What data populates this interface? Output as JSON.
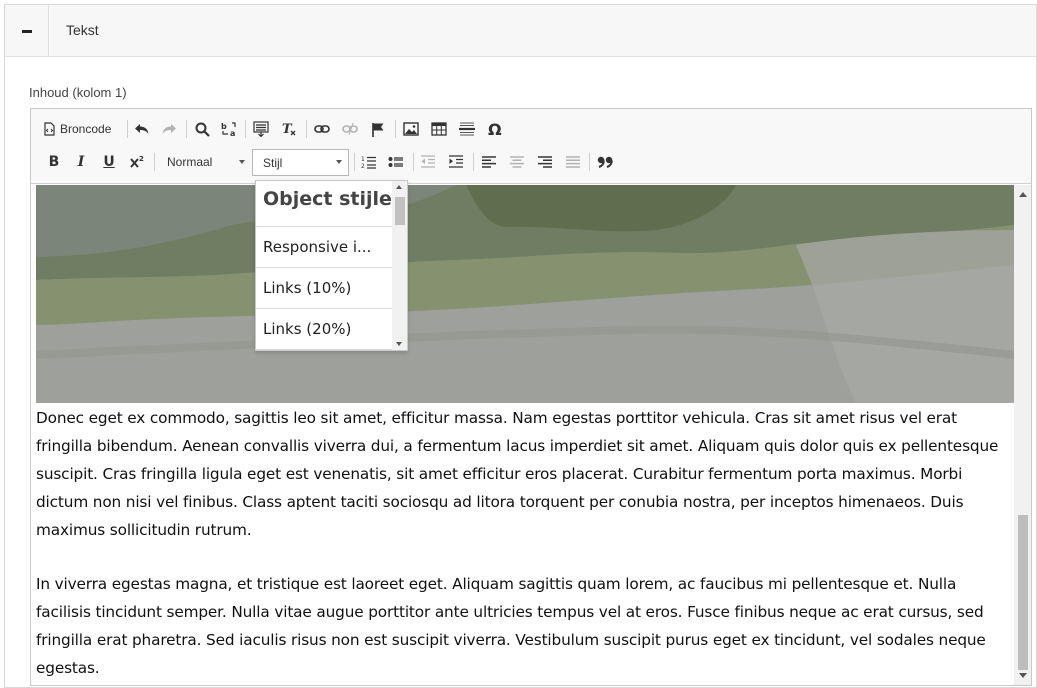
{
  "panel": {
    "title": "Tekst",
    "toggle_icon": "minus-icon"
  },
  "field": {
    "label": "Inhoud (kolom 1)"
  },
  "toolbar": {
    "source_label": "Broncode",
    "format_value": "Normaal",
    "style_value": "Stijl"
  },
  "style_dropdown": {
    "heading": "Object stijlen",
    "items": [
      "Responsive i...",
      "Links (10%)",
      "Links (20%)"
    ]
  },
  "content": {
    "paragraphs": [
      "Donec eget ex commodo, sagittis leo sit amet, efficitur massa. Nam egestas porttitor vehicula. Cras sit amet risus vel erat fringilla bibendum. Aenean convallis viverra dui, a fermentum lacus imperdiet sit amet. Aliquam quis dolor quis ex pellentesque suscipit. Cras fringilla ligula eget est venenatis, sit amet efficitur eros placerat. Curabitur fermentum porta maximus. Morbi dictum non nisi vel finibus. Class aptent taciti sociosqu ad litora torquent per conubia nostra, per inceptos himenaeos. Duis maximus sollicitudin rutrum.",
      "In viverra egestas magna, et tristique est laoreet eget. Aliquam sagittis quam lorem, ac faucibus mi pellentesque et. Nulla facilisis tincidunt semper. Nulla vitae augue porttitor ante ultricies tempus vel at eros. Fusce finibus neque ac erat cursus, sed fringilla erat pharetra. Sed iaculis risus non est suscipit viverra. Vestibulum suscipit purus eget ex tincidunt, vel sodales neque egestas."
    ]
  }
}
